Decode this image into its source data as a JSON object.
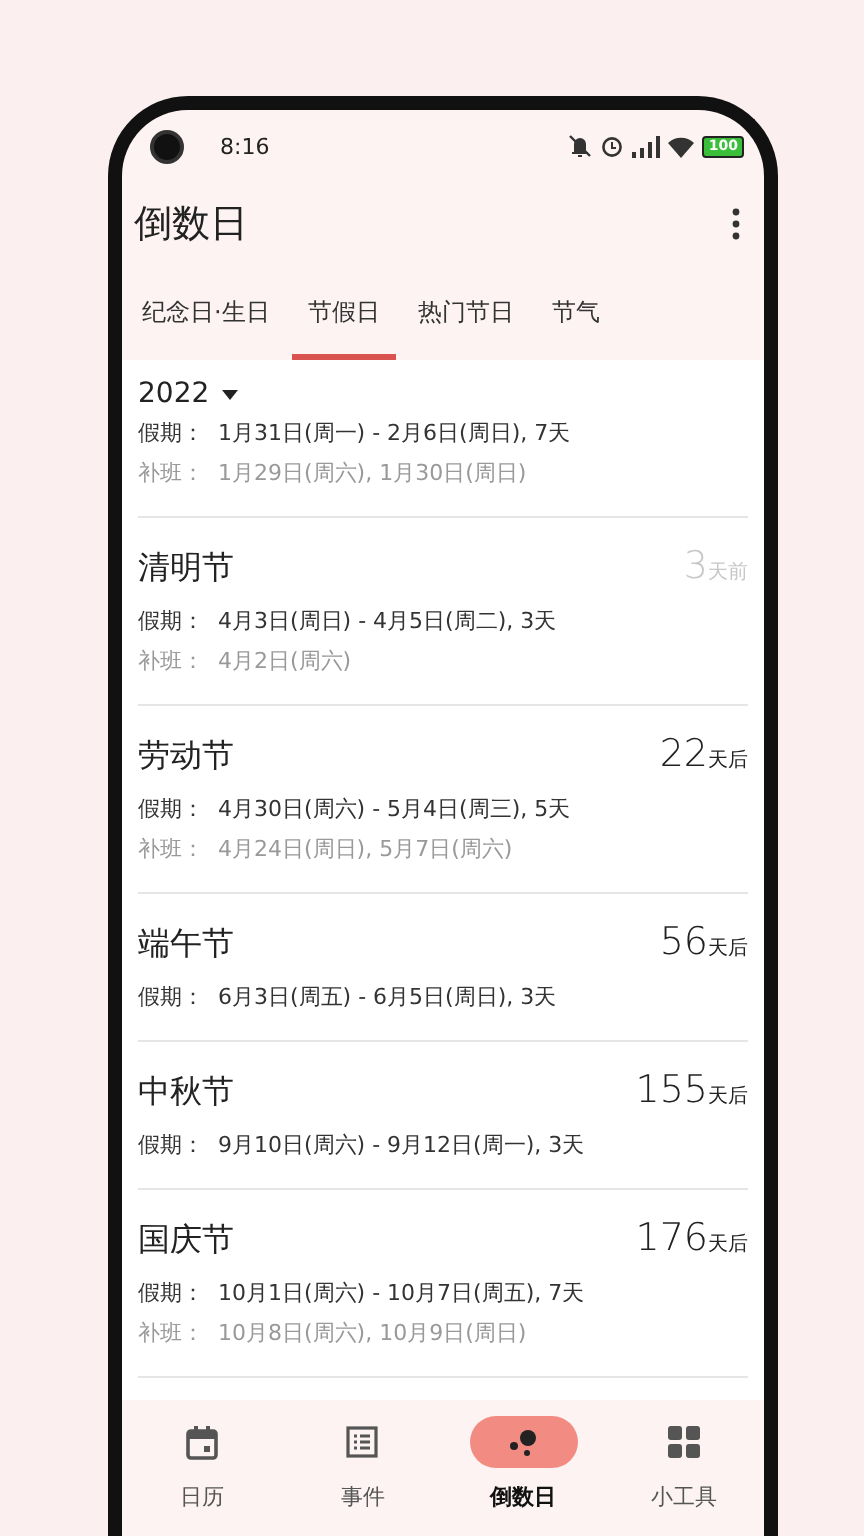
{
  "status_bar": {
    "time": "8:16",
    "battery": "100"
  },
  "app_bar": {
    "title": "倒数日"
  },
  "tabs": [
    {
      "label": "纪念日·生日",
      "selected": false
    },
    {
      "label": "节假日",
      "selected": true
    },
    {
      "label": "热门节日",
      "selected": false
    },
    {
      "label": "节气",
      "selected": false
    }
  ],
  "year_selector": {
    "year": "2022"
  },
  "holidays": [
    {
      "vacation_label": "假期：",
      "vacation": "1月31日(周一) - 2月6日(周日), 7天",
      "makeup_label": "补班：",
      "makeup": "1月29日(周六), 1月30日(周日)"
    },
    {
      "name": "清明节",
      "count": "3",
      "unit": "天前",
      "past": true,
      "vacation_label": "假期：",
      "vacation": "4月3日(周日) - 4月5日(周二), 3天",
      "makeup_label": "补班：",
      "makeup": "4月2日(周六)"
    },
    {
      "name": "劳动节",
      "count": "22",
      "unit": "天后",
      "past": false,
      "vacation_label": "假期：",
      "vacation": "4月30日(周六) - 5月4日(周三), 5天",
      "makeup_label": "补班：",
      "makeup": "4月24日(周日), 5月7日(周六)"
    },
    {
      "name": "端午节",
      "count": "56",
      "unit": "天后",
      "past": false,
      "vacation_label": "假期：",
      "vacation": "6月3日(周五) - 6月5日(周日), 3天"
    },
    {
      "name": "中秋节",
      "count": "155",
      "unit": "天后",
      "past": false,
      "vacation_label": "假期：",
      "vacation": "9月10日(周六) - 9月12日(周一), 3天"
    },
    {
      "name": "国庆节",
      "count": "176",
      "unit": "天后",
      "past": false,
      "vacation_label": "假期：",
      "vacation": "10月1日(周六) - 10月7日(周五), 7天",
      "makeup_label": "补班：",
      "makeup": "10月8日(周六), 10月9日(周日)"
    }
  ],
  "bottom_nav": [
    {
      "label": "日历",
      "selected": false
    },
    {
      "label": "事件",
      "selected": false
    },
    {
      "label": "倒数日",
      "selected": true
    },
    {
      "label": "小工具",
      "selected": false
    }
  ]
}
